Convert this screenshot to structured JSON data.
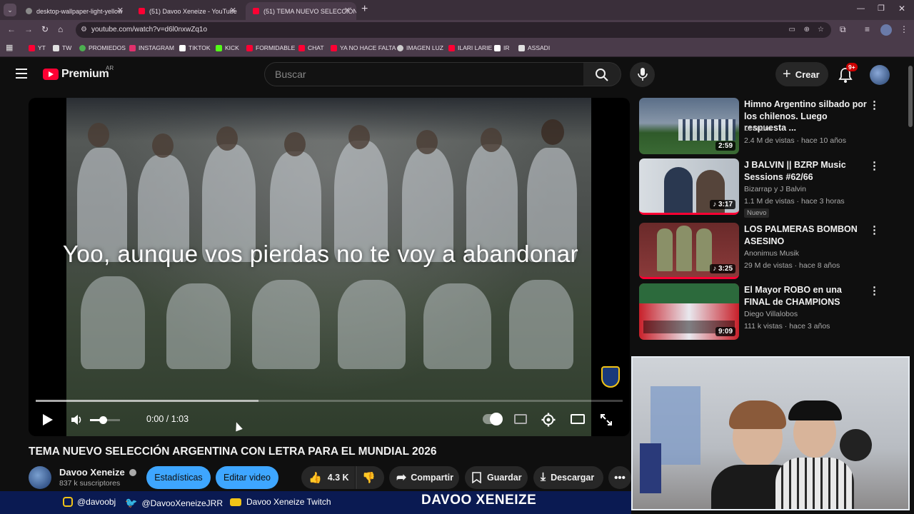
{
  "browser": {
    "tabs": [
      {
        "title": "desktop-wallpaper-light-yellow",
        "fav_color": "#8a8a8a"
      },
      {
        "title": "(51) Davoo Xeneize - YouTube",
        "fav_color": "#ff0033"
      },
      {
        "title": "(51) TEMA NUEVO SELECCIÓN",
        "fav_color": "#ff0033"
      }
    ],
    "new_tab": "+",
    "url": "youtube.com/watch?v=d6l0nxwZq1o",
    "bookmarks": [
      {
        "label": "YT",
        "color": "#ff0033"
      },
      {
        "label": "TW",
        "color": "#e0e0e0"
      },
      {
        "label": "PROMIEDOS",
        "color": "#4caf50"
      },
      {
        "label": "INSTAGRAM",
        "color": "#e1306c"
      },
      {
        "label": "TIKTOK",
        "color": "#ffffff"
      },
      {
        "label": "KICK",
        "color": "#53fc18"
      },
      {
        "label": "FORMIDABLE",
        "color": "#ff0033"
      },
      {
        "label": "CHAT",
        "color": "#ff0033"
      },
      {
        "label": "YA NO HACE FALTA",
        "color": "#ff0033"
      },
      {
        "label": "IMAGEN LUZ",
        "color": "#cccccc"
      },
      {
        "label": "ILARI LARIE",
        "color": "#ff0033"
      },
      {
        "label": "IR",
        "color": "#ffffff"
      },
      {
        "label": "ASSADI",
        "color": "#e0e0e0"
      }
    ]
  },
  "header": {
    "logo_text": "Premium",
    "region": "AR",
    "search_placeholder": "Buscar",
    "create_label": "Crear",
    "notif_count": "9+"
  },
  "player": {
    "caption": "Yoo, aunque vos pierdas no te voy a abandonar",
    "time": "0:00 / 1:03",
    "progress_fraction": 0.0,
    "volume_fraction": 0.45
  },
  "video": {
    "title": "TEMA NUEVO SELECCIÓN ARGENTINA CON LETRA PARA EL MUNDIAL 2026",
    "channel": "Davoo Xeneize",
    "subscribers": "837 k suscriptores",
    "stats_label": "Estadísticas",
    "edit_label": "Editar video",
    "likes": "4.3 K",
    "share_label": "Compartir",
    "save_label": "Guardar",
    "download_label": "Descargar"
  },
  "recommendations": [
    {
      "title": "Himno Argentino silbado por los chilenos. Luego respuesta ...",
      "channel": "Leandro",
      "meta": "2.4 M de vistas · hace 10 años",
      "duration": "2:59",
      "badge": ""
    },
    {
      "title": "J BALVIN || BZRP Music Sessions #62/66",
      "channel": "Bizarrap  y J Balvin",
      "meta": "1.1 M de vistas · hace 3 horas",
      "duration": "3:17",
      "badge": "Nuevo"
    },
    {
      "title": "LOS PALMERAS BOMBON ASESINO",
      "channel": "Anonimus Musik",
      "meta": "29 M de vistas · hace 8 años",
      "duration": "3:25",
      "badge": ""
    },
    {
      "title": "El Mayor ROBO en una FINAL de CHAMPIONS",
      "channel": "Diego Villalobos",
      "meta": "111 k vistas · hace 3 años",
      "duration": "9:09",
      "badge": ""
    }
  ],
  "overlay": {
    "instagram": "@davoobj",
    "twitter": "@DavooXeneizeJRR",
    "twitch": "Davoo Xeneize Twitch",
    "brand": "DAVOO XENEIZE"
  }
}
